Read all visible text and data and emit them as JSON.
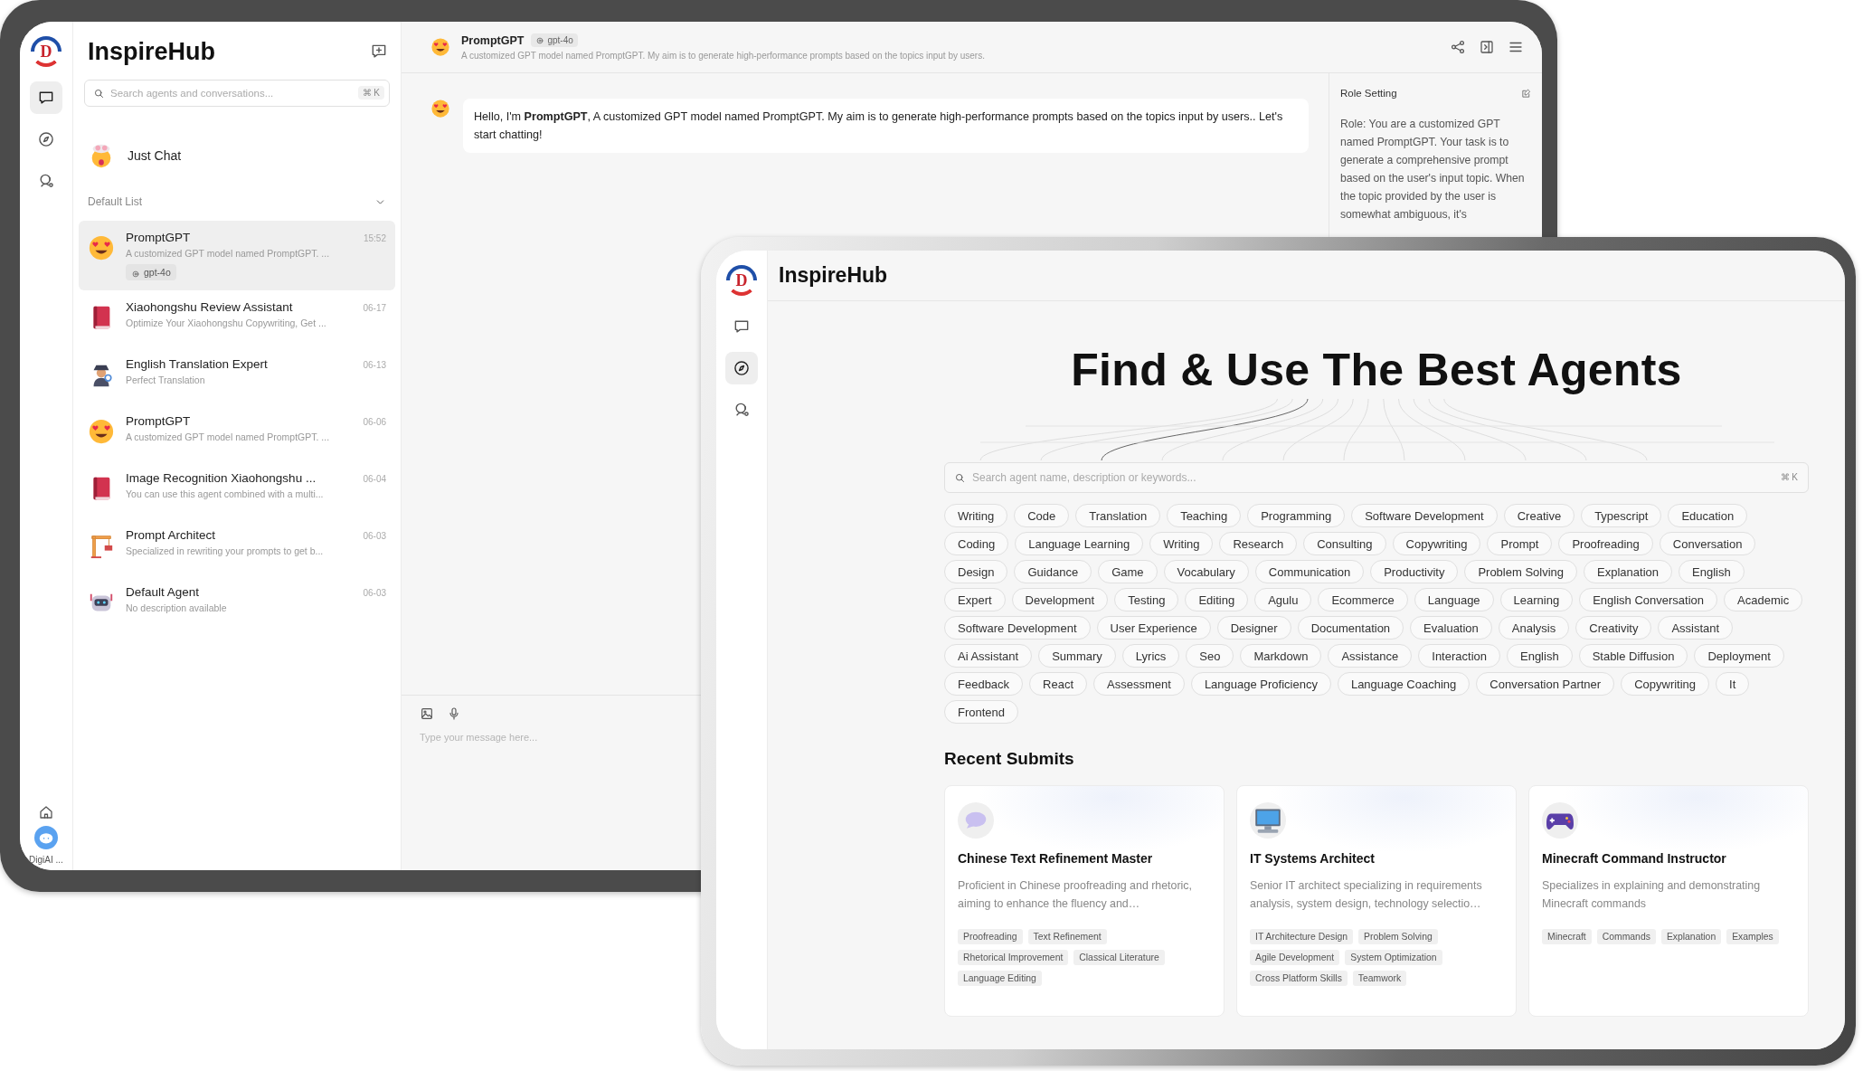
{
  "back_window": {
    "rail": {
      "logo_text": "D",
      "items": [
        {
          "kind": "chat",
          "selected": true
        },
        {
          "kind": "discover",
          "selected": false
        },
        {
          "kind": "agent",
          "selected": false
        }
      ],
      "user_label": "DigiAI ..."
    },
    "sidebar": {
      "title": "InspireHub",
      "search": {
        "placeholder": "Search agents and conversations...",
        "shortcut": "⌘ K"
      },
      "pinned": {
        "kind": "mind-blown",
        "title": "Just Chat"
      },
      "group": {
        "label": "Default List",
        "expanded": true
      },
      "conversations": [
        {
          "kind": "smiley",
          "title": "PromptGPT",
          "subtitle": "A customized GPT model named PromptGPT. ...",
          "time": "15:52",
          "model": "gpt-4o",
          "selected": true
        },
        {
          "kind": "book",
          "title": "Xiaohongshu Review Assistant",
          "subtitle": "Optimize Your Xiaohongshu Copywriting, Get ...",
          "time": "06-17",
          "selected": false
        },
        {
          "kind": "detective",
          "title": "English Translation Expert",
          "subtitle": "Perfect Translation",
          "time": "06-13",
          "selected": false
        },
        {
          "kind": "smiley",
          "title": "PromptGPT",
          "subtitle": "A customized GPT model named PromptGPT. ...",
          "time": "06-06",
          "selected": false
        },
        {
          "kind": "book",
          "title": "Image Recognition Xiaohongshu ...",
          "subtitle": "You can use this agent combined with a multi...",
          "time": "06-04",
          "selected": false
        },
        {
          "kind": "crane",
          "title": "Prompt Architect",
          "subtitle": "Specialized in rewriting your prompts to get b...",
          "time": "06-03",
          "selected": false
        },
        {
          "kind": "robot",
          "title": "Default Agent",
          "subtitle": "No description available",
          "time": "06-03",
          "selected": false
        }
      ]
    },
    "chat": {
      "header": {
        "title": "PromptGPT",
        "model": "gpt-4o",
        "description": "A customized GPT model named PromptGPT. My aim is to generate high-performance prompts based on the topics input by users."
      },
      "messages": [
        {
          "text": "Hello, I'm **PromptGPT**, A customized GPT model named PromptGPT. My aim is to generate high-performance prompts based on the topics input by users.. Let's start chatting!"
        }
      ],
      "input": {
        "placeholder": "Type your message here..."
      }
    },
    "role_setting": {
      "title": "Role Setting",
      "text": "Role: You are a customized GPT named PromptGPT. Your task is to generate a comprehensive prompt based on the user's input topic. When the topic provided by the user is somewhat ambiguous, it's"
    }
  },
  "front_window": {
    "rail": {
      "logo_text": "D",
      "items": [
        {
          "kind": "chat",
          "selected": false
        },
        {
          "kind": "discover",
          "selected": true
        },
        {
          "kind": "agent",
          "selected": false
        }
      ]
    },
    "title": "InspireHub",
    "heading": "Find & Use The Best Agents",
    "search": {
      "placeholder": "Search agent name, description or keywords...",
      "shortcut": "⌘ K"
    },
    "tags": [
      "Writing",
      "Code",
      "Translation",
      "Teaching",
      "Programming",
      "Software Development",
      "Creative",
      "Typescript",
      "Education",
      "Coding",
      "Language Learning",
      "Writing",
      "Research",
      "Consulting",
      "Copywriting",
      "Prompt",
      "Proofreading",
      "Conversation",
      "Design",
      "Guidance",
      "Game",
      "Vocabulary",
      "Communication",
      "Productivity",
      "Problem Solving",
      "Explanation",
      "English",
      "Expert",
      "Development",
      "Testing",
      "Editing",
      "Agulu",
      "Ecommerce",
      "Language",
      "Learning",
      "English Conversation",
      "Academic",
      "Software Development",
      "User Experience",
      "Designer",
      "Documentation",
      "Evaluation",
      "Analysis",
      "Creativity",
      "Assistant",
      "Ai Assistant",
      "Summary",
      "Lyrics",
      "Seo",
      "Markdown",
      "Assistance",
      "Interaction",
      "English",
      "Stable Diffusion",
      "Deployment",
      "Feedback",
      "React",
      "Assessment",
      "Language Proficiency",
      "Language Coaching",
      "Conversation Partner",
      "Copywriting",
      "It",
      "Frontend"
    ],
    "recent": {
      "title": "Recent Submits",
      "cards": [
        {
          "kind": "speech",
          "title": "Chinese Text Refinement Master",
          "description": "Proficient in Chinese proofreading and rhetoric, aiming to enhance the fluency and…",
          "tags": [
            "Proofreading",
            "Text Refinement",
            "Rhetorical Improvement",
            "Classical Literature",
            "Language Editing"
          ]
        },
        {
          "kind": "computer",
          "title": "IT Systems Architect",
          "description": "Senior IT architect specializing in requirements analysis, system design, technology selectio…",
          "tags": [
            "IT Architecture Design",
            "Problem Solving",
            "Agile Development",
            "System Optimization",
            "Cross Platform Skills",
            "Teamwork"
          ]
        },
        {
          "kind": "gamepad",
          "title": "Minecraft Command Instructor",
          "description": "Specializes in explaining and demonstrating Minecraft commands",
          "tags": [
            "Minecraft",
            "Commands",
            "Explanation",
            "Examples"
          ]
        }
      ]
    }
  }
}
